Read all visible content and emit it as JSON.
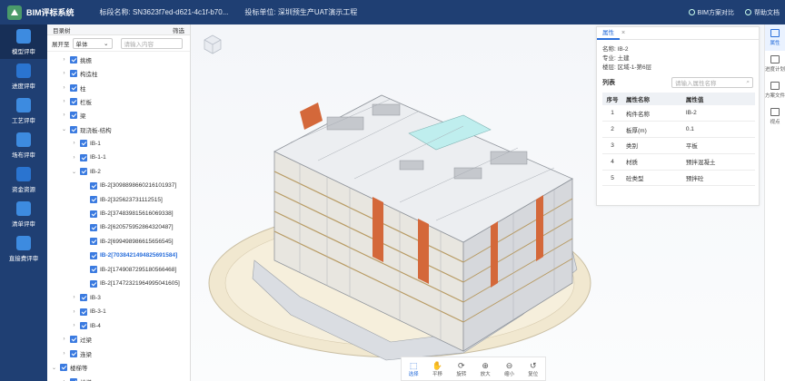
{
  "app": {
    "title": "BIM评标系统"
  },
  "header": {
    "section_label": "标段名称:",
    "section_value": "SN3623f7ed-d621-4c1f-b70...",
    "bidder_label": "投标单位:",
    "bidder_value": "深圳预生产UAT演示工程",
    "compare_label": "BIM方案对比",
    "help_label": "帮助文档"
  },
  "leftnav": {
    "items": [
      {
        "label": "模型评审",
        "active": true
      },
      {
        "label": "进度评审"
      },
      {
        "label": "工艺评审"
      },
      {
        "label": "场布评审"
      },
      {
        "label": "资金资源"
      },
      {
        "label": "清单评审"
      },
      {
        "label": "直接费评审"
      }
    ]
  },
  "tree": {
    "title": "目录树",
    "filter_label": "筛选",
    "expand_label": "展开至",
    "select_value": "单体",
    "search_placeholder": "请输入内容",
    "rows": [
      {
        "label": "挑檐",
        "indent": 1,
        "caret": "›"
      },
      {
        "label": "构造柱",
        "indent": 1,
        "caret": "›"
      },
      {
        "label": "柱",
        "indent": 1,
        "caret": "›"
      },
      {
        "label": "栏板",
        "indent": 1,
        "caret": "›"
      },
      {
        "label": "梁",
        "indent": 1,
        "caret": "›"
      },
      {
        "label": "现浇板-结构",
        "indent": 1,
        "caret": "⌄"
      },
      {
        "label": "IB-1",
        "indent": 2,
        "caret": "›"
      },
      {
        "label": "IB-1-1",
        "indent": 2,
        "caret": "›"
      },
      {
        "label": "IB-2",
        "indent": 2,
        "caret": "⌄"
      },
      {
        "label": "IB-2[3098898660216101937]",
        "indent": 3,
        "caret": ""
      },
      {
        "label": "IB-2[325623731112515]",
        "indent": 3,
        "caret": ""
      },
      {
        "label": "IB-2[374839815616069338]",
        "indent": 3,
        "caret": ""
      },
      {
        "label": "IB-2[620575952864320487]",
        "indent": 3,
        "caret": ""
      },
      {
        "label": "IB-2[699498986615656545]",
        "indent": 3,
        "caret": ""
      },
      {
        "label": "IB-2[703842149482569158​4]",
        "indent": 3,
        "caret": "",
        "highlight": true
      },
      {
        "label": "IB-2[174908729518056646​8]",
        "indent": 3,
        "caret": ""
      },
      {
        "label": "IB-2[174723219649950416​05]",
        "indent": 3,
        "caret": ""
      },
      {
        "label": "IB-3",
        "indent": 2,
        "caret": "›"
      },
      {
        "label": "IB-3-1",
        "indent": 2,
        "caret": "›"
      },
      {
        "label": "IB-4",
        "indent": 2,
        "caret": "›"
      },
      {
        "label": "过梁",
        "indent": 1,
        "caret": "›"
      },
      {
        "label": "连梁",
        "indent": 1,
        "caret": "›"
      },
      {
        "label": "楼梯等",
        "indent": 0,
        "caret": "⌄"
      },
      {
        "label": "楼梯",
        "indent": 1,
        "caret": "›"
      }
    ]
  },
  "properties": {
    "tab_label": "属性",
    "close": "×",
    "name": "名称: IB-2",
    "major": "专业: 土建",
    "floor": "楼层: 区域-1-第6层",
    "list_label": "列表",
    "search_placeholder": "请输入属性名称",
    "columns": [
      "序号",
      "属性名称",
      "属性值"
    ],
    "rows": [
      {
        "no": "1",
        "name": "构件名称",
        "value": "IB-2"
      },
      {
        "no": "2",
        "name": "板厚(m)",
        "value": "0.1"
      },
      {
        "no": "3",
        "name": "类别",
        "value": "平板"
      },
      {
        "no": "4",
        "name": "材质",
        "value": "预拌混凝土"
      },
      {
        "no": "5",
        "name": "砼类型",
        "value": "预拌砼"
      }
    ]
  },
  "right_tools": [
    {
      "label": "属性",
      "active": true
    },
    {
      "label": "进度计划"
    },
    {
      "label": "方案文件"
    },
    {
      "label": "视点"
    }
  ],
  "bottom_tools": [
    {
      "label": "选择",
      "icon": "⬚",
      "active": true
    },
    {
      "label": "平移",
      "icon": "✋"
    },
    {
      "label": "旋转",
      "icon": "⟳"
    },
    {
      "label": "放大",
      "icon": "⊕"
    },
    {
      "label": "缩小",
      "icon": "⊖"
    },
    {
      "label": "复位",
      "icon": "↺"
    }
  ]
}
